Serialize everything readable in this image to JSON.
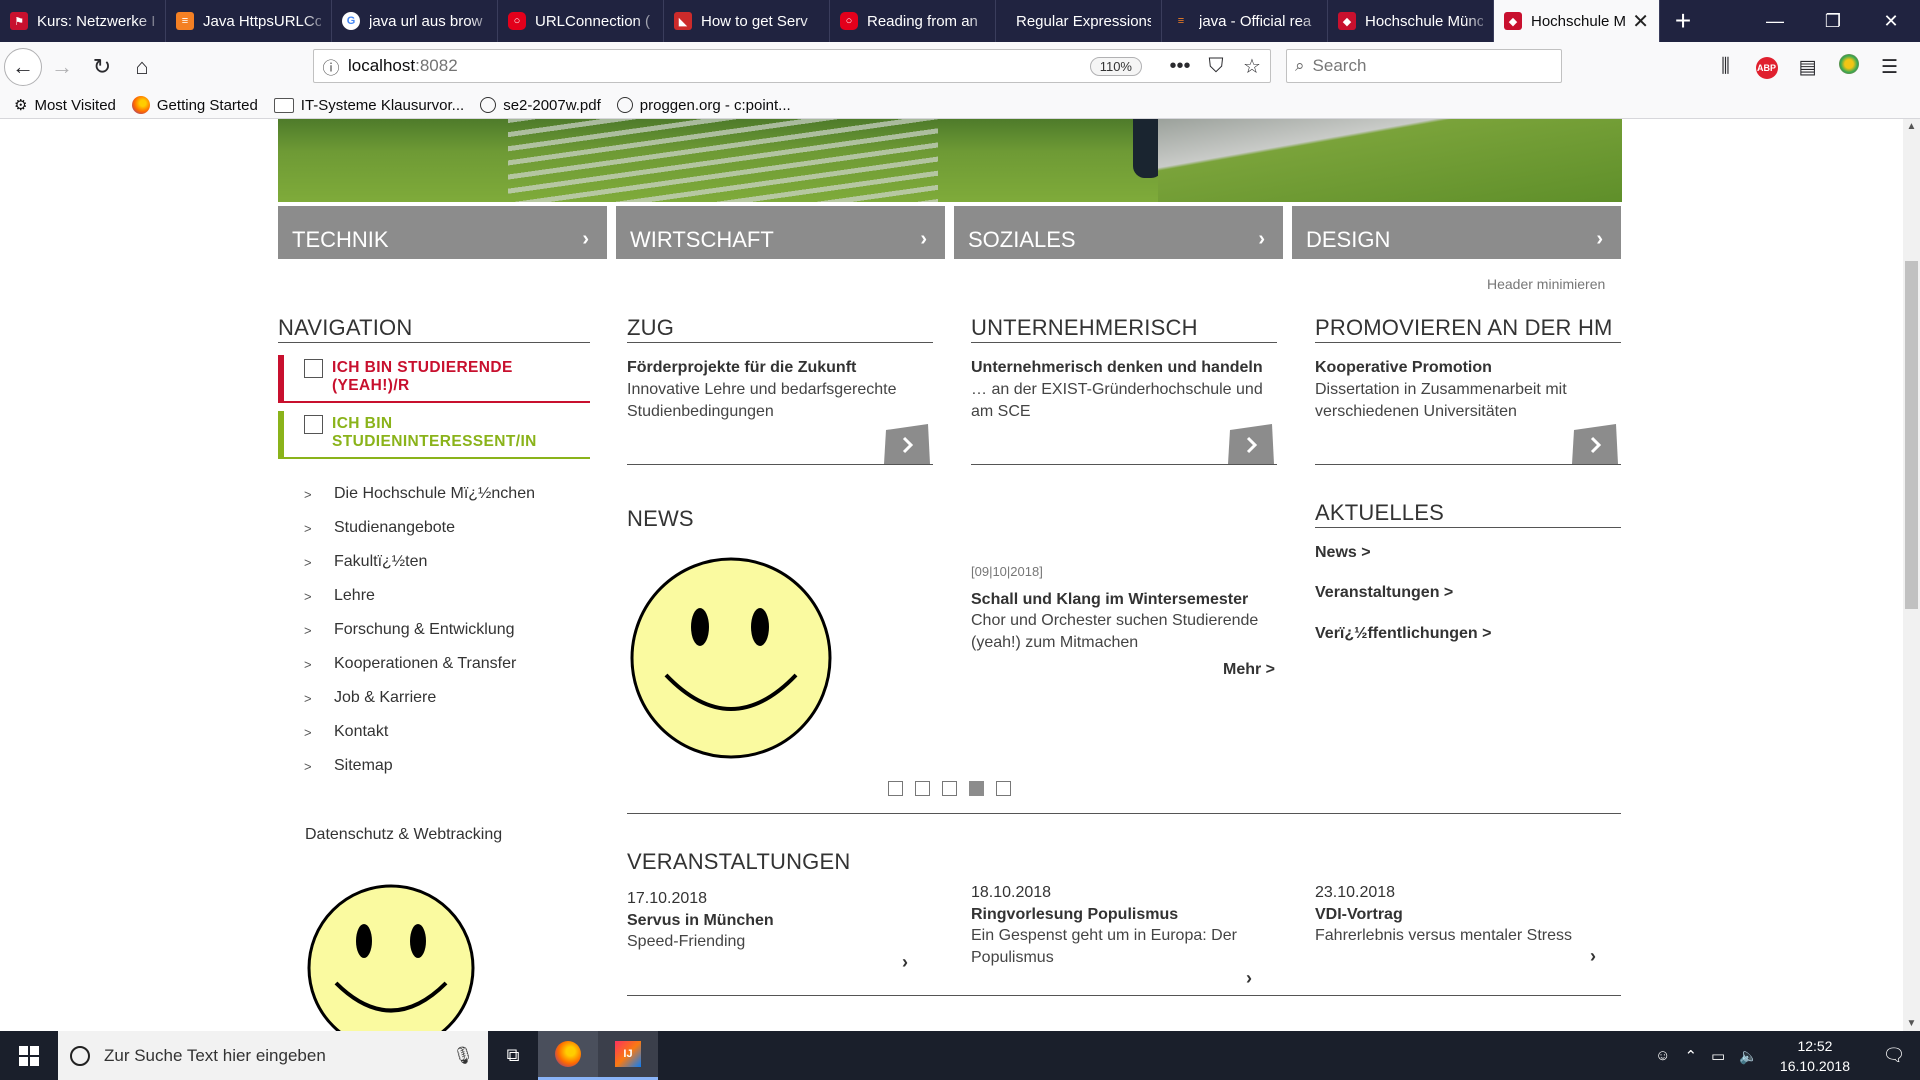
{
  "browser": {
    "tabs": [
      {
        "label": "Kurs: Netzwerke I",
        "icon": "moodle-icon",
        "color": "#c8102e",
        "active": false
      },
      {
        "label": "Java HttpsURLCo",
        "icon": "stackoverflow-icon",
        "color": "#f48024",
        "active": false
      },
      {
        "label": "java url aus brow",
        "icon": "google-icon",
        "color": "#4285f4",
        "active": false
      },
      {
        "label": "URLConnection (",
        "icon": "oracle-icon",
        "color": "#e3001b",
        "active": false
      },
      {
        "label": "How to get Serv",
        "icon": "page-icon",
        "color": "#cc2b2b",
        "active": false
      },
      {
        "label": "Reading from an",
        "icon": "oracle-icon",
        "color": "#e3001b",
        "active": false
      },
      {
        "label": "Regular Expressions",
        "icon": "none",
        "color": "#202340",
        "active": false
      },
      {
        "label": "java - Official rea",
        "icon": "stackoverflow-icon",
        "color": "#f48024",
        "active": false
      },
      {
        "label": "Hochschule Münc",
        "icon": "hm-icon",
        "color": "#c8102e",
        "active": false
      },
      {
        "label": "Hochschule M",
        "icon": "hm-icon",
        "color": "#c8102e",
        "active": true
      }
    ],
    "new_tab": "+",
    "url_host": "localhost",
    "url_port": ":8082",
    "zoom": "110%",
    "search_placeholder": "Search",
    "bookmarks": [
      {
        "label": "Most Visited",
        "icon": "gear-icon"
      },
      {
        "label": "Getting Started",
        "icon": "firefox-icon"
      },
      {
        "label": "IT-Systeme Klausurvor...",
        "icon": "folder-icon"
      },
      {
        "label": "se2-2007w.pdf",
        "icon": "globe-icon"
      },
      {
        "label": "proggen.org - c:point...",
        "icon": "globe-icon"
      }
    ]
  },
  "page": {
    "categories": [
      "TECHNIK",
      "WIRTSCHAFT",
      "SOZIALES",
      "DESIGN"
    ],
    "header_minimize": "Header minimieren",
    "navigation": {
      "title": "NAVIGATION",
      "box_student": "ICH BIN STUDIERENDE (YEAH!)/R",
      "box_interested": "ICH BIN STUDIENINTERESSENT/IN",
      "items": [
        "Die Hochschule Mï¿½nchen",
        "Studienangebote",
        "Fakultï¿½ten",
        "Lehre",
        "Forschung & Entwicklung",
        "Kooperationen & Transfer",
        "Job & Karriere",
        "Kontakt",
        "Sitemap"
      ],
      "privacy": "Datenschutz & Webtracking"
    },
    "features": [
      {
        "heading": "ZUG",
        "title": "Förderprojekte für die Zukunft",
        "desc": "Innovative Lehre und bedarfsgerechte Studienbedingungen"
      },
      {
        "heading": "UNTERNEHMERISCH",
        "title": "Unternehmerisch denken und handeln",
        "desc": "… an der EXIST-Gründerhochschule und am SCE"
      },
      {
        "heading": "PROMOVIEREN AN DER HM",
        "title": "Kooperative Promotion",
        "desc": "Dissertation in Zusammenarbeit mit verschiedenen Universitäten"
      }
    ],
    "news": {
      "heading": "NEWS",
      "date": "[09|10|2018]",
      "title": "Schall und Klang im Wintersemester",
      "desc": "Chor und Orchester suchen Studierende (yeah!) zum Mitmachen",
      "more": "Mehr >",
      "slider_count": 5,
      "slider_active": 4
    },
    "aktuelles": {
      "heading": "AKTUELLES",
      "links": [
        "News >",
        "Veranstaltungen >",
        "Verï¿½ffentlichungen >"
      ]
    },
    "events": {
      "heading": "VERANSTALTUNGEN",
      "items": [
        {
          "date": "17.10.2018",
          "title": "Servus in München",
          "desc": "Speed-Friending"
        },
        {
          "date": "18.10.2018",
          "title": "Ringvorlesung Populismus",
          "desc": "Ein Gespenst geht um in Europa: Der Populismus"
        },
        {
          "date": "23.10.2018",
          "title": "VDI-Vortrag",
          "desc": "Fahrerlebnis versus mentaler Stress"
        }
      ]
    },
    "colors": {
      "red": "#c8102e",
      "green": "#8ab31a",
      "category_gray": "#8c8c8c",
      "smiley": "#fafaa0"
    }
  },
  "taskbar": {
    "search_placeholder": "Zur Suche Text hier eingeben",
    "time": "12:52",
    "date": "16.10.2018"
  }
}
